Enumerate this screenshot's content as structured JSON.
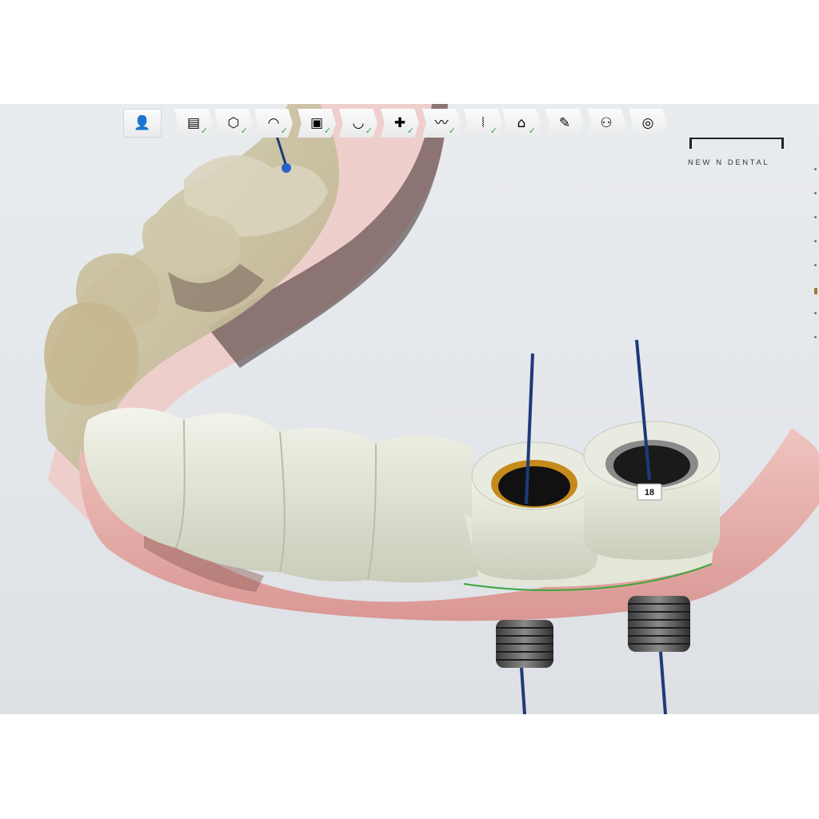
{
  "brand": {
    "name": "NEW N DENTAL"
  },
  "toolbar": {
    "items": [
      {
        "id": "patient",
        "icon": "patient-photo-icon",
        "glyph": "👤",
        "check": false
      },
      {
        "id": "order-form",
        "icon": "order-form-icon",
        "glyph": "▤",
        "check": true
      },
      {
        "id": "scan",
        "icon": "scanner-icon",
        "glyph": "⬡",
        "check": true
      },
      {
        "id": "tooth",
        "icon": "tooth-icon",
        "glyph": "◠",
        "check": true
      },
      {
        "id": "model",
        "icon": "model-box-icon",
        "glyph": "▣",
        "check": true
      },
      {
        "id": "arch",
        "icon": "arch-icon",
        "glyph": "◡",
        "check": true
      },
      {
        "id": "add-element",
        "icon": "add-element-icon",
        "glyph": "✚",
        "check": true
      },
      {
        "id": "gingiva",
        "icon": "gingiva-icon",
        "glyph": "〰",
        "check": true
      },
      {
        "id": "implant",
        "icon": "implant-screw-icon",
        "glyph": "⦚",
        "check": true
      },
      {
        "id": "abutment",
        "icon": "abutment-icon",
        "glyph": "⌂",
        "check": true
      },
      {
        "id": "design",
        "icon": "design-tool-icon",
        "glyph": "✎",
        "check": false
      },
      {
        "id": "users",
        "icon": "users-icon",
        "glyph": "⚇",
        "check": false
      },
      {
        "id": "output",
        "icon": "output-disk-icon",
        "glyph": "◎",
        "check": false
      }
    ]
  },
  "scene": {
    "implants": [
      {
        "label": "",
        "ring_color": "#c58a1a"
      },
      {
        "label": "18",
        "ring_color": "#8a8a8a"
      }
    ]
  },
  "colors": {
    "gingiva": "#e4a4a0",
    "crown": "#dfe3d2",
    "check": "#3aa63a",
    "pin": "#1d3a7a"
  }
}
